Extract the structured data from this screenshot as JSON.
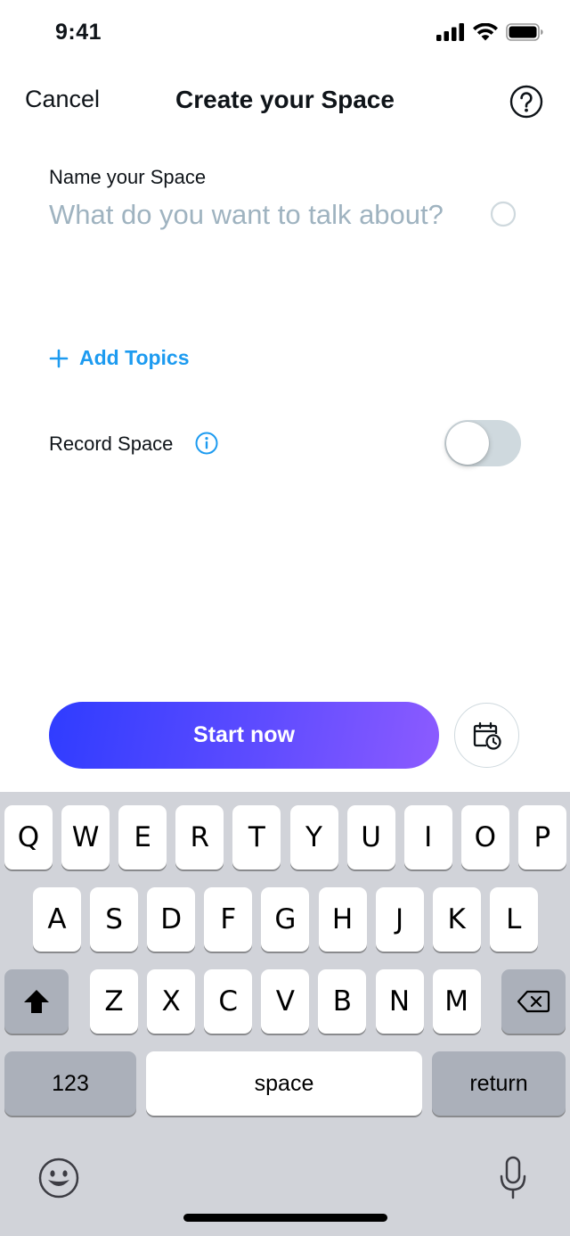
{
  "status_bar": {
    "time": "9:41"
  },
  "nav": {
    "cancel_label": "Cancel",
    "title": "Create your Space",
    "help_icon": "question-circle-icon"
  },
  "form": {
    "name_label": "Name your Space",
    "name_placeholder": "What do you want to talk about?",
    "name_value": "",
    "add_topics_label": "Add Topics",
    "record_label": "Record Space",
    "record_enabled": false
  },
  "actions": {
    "start_label": "Start now",
    "schedule_icon": "calendar-clock-icon"
  },
  "keyboard": {
    "row1": [
      "Q",
      "W",
      "E",
      "R",
      "T",
      "Y",
      "U",
      "I",
      "O",
      "P"
    ],
    "row2": [
      "A",
      "S",
      "D",
      "F",
      "G",
      "H",
      "J",
      "K",
      "L"
    ],
    "row3": [
      "Z",
      "X",
      "C",
      "V",
      "B",
      "N",
      "M"
    ],
    "numbers_label": "123",
    "space_label": "space",
    "return_label": "return"
  },
  "colors": {
    "accent": "#1d9bf0",
    "button_gradient_start": "#2f3cff",
    "button_gradient_end": "#8c5bff",
    "toggle_off": "#cfd9de"
  }
}
